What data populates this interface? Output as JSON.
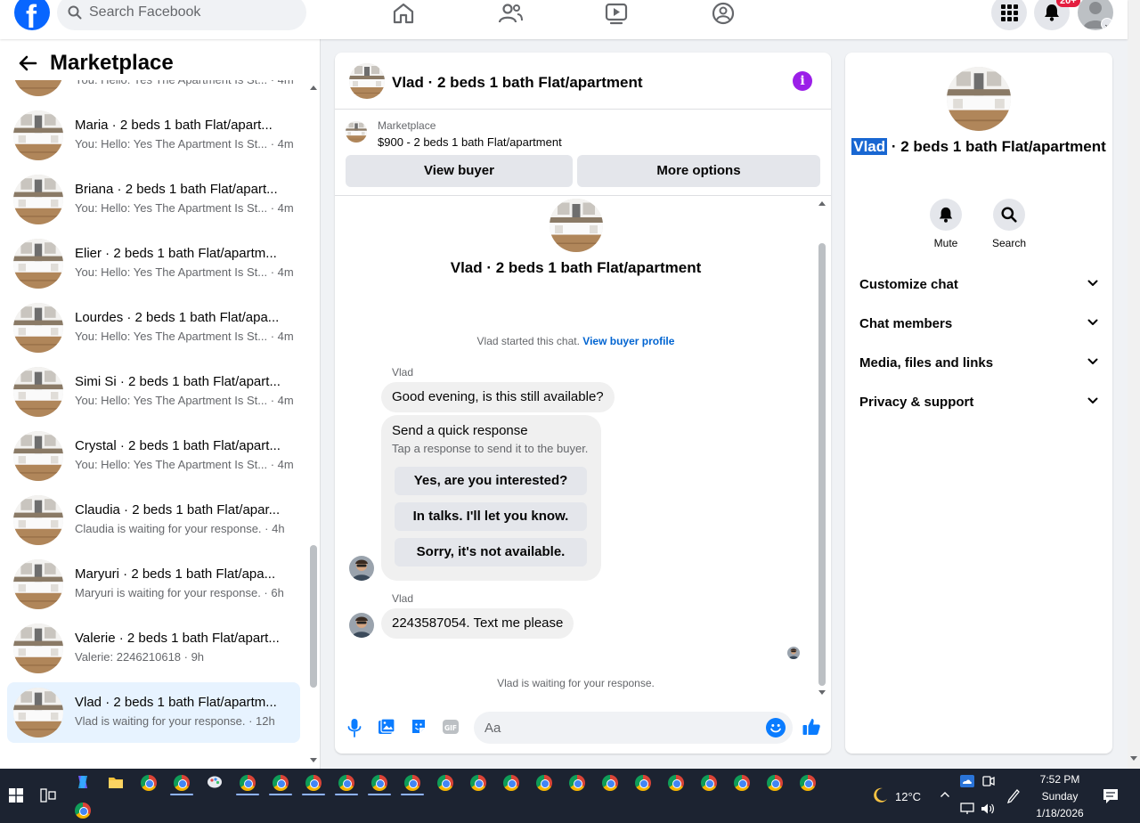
{
  "topbar": {
    "search_placeholder": "Search Facebook",
    "notification_count": "20+",
    "nav_icons": [
      "home-icon",
      "friends-icon",
      "video-icon",
      "groups-icon"
    ],
    "right_icons": [
      "menu-grid-icon",
      "bell-icon",
      "profile-avatar"
    ]
  },
  "sidebar": {
    "title": "Marketplace",
    "conversations": [
      {
        "name": "",
        "snippet": "You: Hello: Yes The Apartment Is St... · 4m",
        "active": false
      },
      {
        "name": "Maria · 2 beds 1 bath Flat/apart...",
        "snippet": "You: Hello: Yes The Apartment Is St... · 4m",
        "active": false
      },
      {
        "name": "Briana · 2 beds 1 bath Flat/apart...",
        "snippet": "You: Hello: Yes The Apartment Is St... · 4m",
        "active": false
      },
      {
        "name": "Elier · 2 beds 1 bath Flat/apartm...",
        "snippet": "You: Hello: Yes The Apartment Is St... · 4m",
        "active": false
      },
      {
        "name": "Lourdes · 2 beds 1 bath Flat/apa...",
        "snippet": "You: Hello: Yes The Apartment Is St... · 4m",
        "active": false
      },
      {
        "name": "Simi Si · 2 beds 1 bath Flat/apart...",
        "snippet": "You: Hello: Yes The Apartment Is St... · 4m",
        "active": false
      },
      {
        "name": "Crystal · 2 beds 1 bath Flat/apart...",
        "snippet": "You: Hello: Yes The Apartment Is St... · 4m",
        "active": false
      },
      {
        "name": "Claudia · 2 beds 1 bath Flat/apar...",
        "snippet": "Claudia is waiting for your response. · 4h",
        "active": false
      },
      {
        "name": "Maryuri · 2 beds 1 bath Flat/apa...",
        "snippet": "Maryuri is waiting for your response. · 6h",
        "active": false
      },
      {
        "name": "Valerie · 2 beds 1 bath Flat/apart...",
        "snippet": "Valerie: 2246210618 · 9h",
        "active": false
      },
      {
        "name": "Vlad · 2 beds 1 bath Flat/apartm...",
        "snippet": "Vlad is waiting for your response. · 12h",
        "active": true
      }
    ]
  },
  "chat": {
    "title": "Vlad · 2 beds 1 bath Flat/apartment",
    "listing_source": "Marketplace",
    "listing_price": "$900 - 2 beds 1 bath Flat/apartment",
    "view_buyer": "View buyer",
    "more_options": "More options",
    "intro_title": "Vlad · 2 beds 1 bath Flat/apartment",
    "started_text": "Vlad started this chat. ",
    "view_profile_link": "View buyer profile",
    "sender1": "Vlad",
    "message1": "Good evening, is this still available?",
    "quick_title": "Send a quick response",
    "quick_subtitle": "Tap a response to send it to the buyer.",
    "quick_replies": [
      "Yes, are you interested?",
      "In talks. I'll let you know.",
      "Sorry, it's not available."
    ],
    "sender2": "Vlad",
    "message2": "2243587054. Text me please",
    "waiting_text": "Vlad is waiting for your response.",
    "input_placeholder": "Aa",
    "composer_icons": [
      "microphone-icon",
      "photo-icon",
      "sticker-icon",
      "gif-icon",
      "emoji-icon",
      "like-icon"
    ]
  },
  "info_panel": {
    "name_highlight": "Vlad",
    "name_rest": " · 2 beds 1 bath Flat/apartment",
    "mute_label": "Mute",
    "search_label": "Search",
    "sections": [
      "Customize chat",
      "Chat members",
      "Media, files and links",
      "Privacy & support"
    ]
  },
  "taskbar": {
    "temperature": "12°C",
    "time": "7:52 PM",
    "day": "Sunday",
    "date": "1/18/2026",
    "weather_icon": "moon-icon"
  },
  "colors": {
    "facebook_blue": "#0866ff",
    "link_blue": "#0064d1",
    "info_purple": "#9b1fe8",
    "active_row": "#e7f3ff",
    "notification_red": "#e41e3f",
    "taskbar_bg": "#1c2331"
  }
}
